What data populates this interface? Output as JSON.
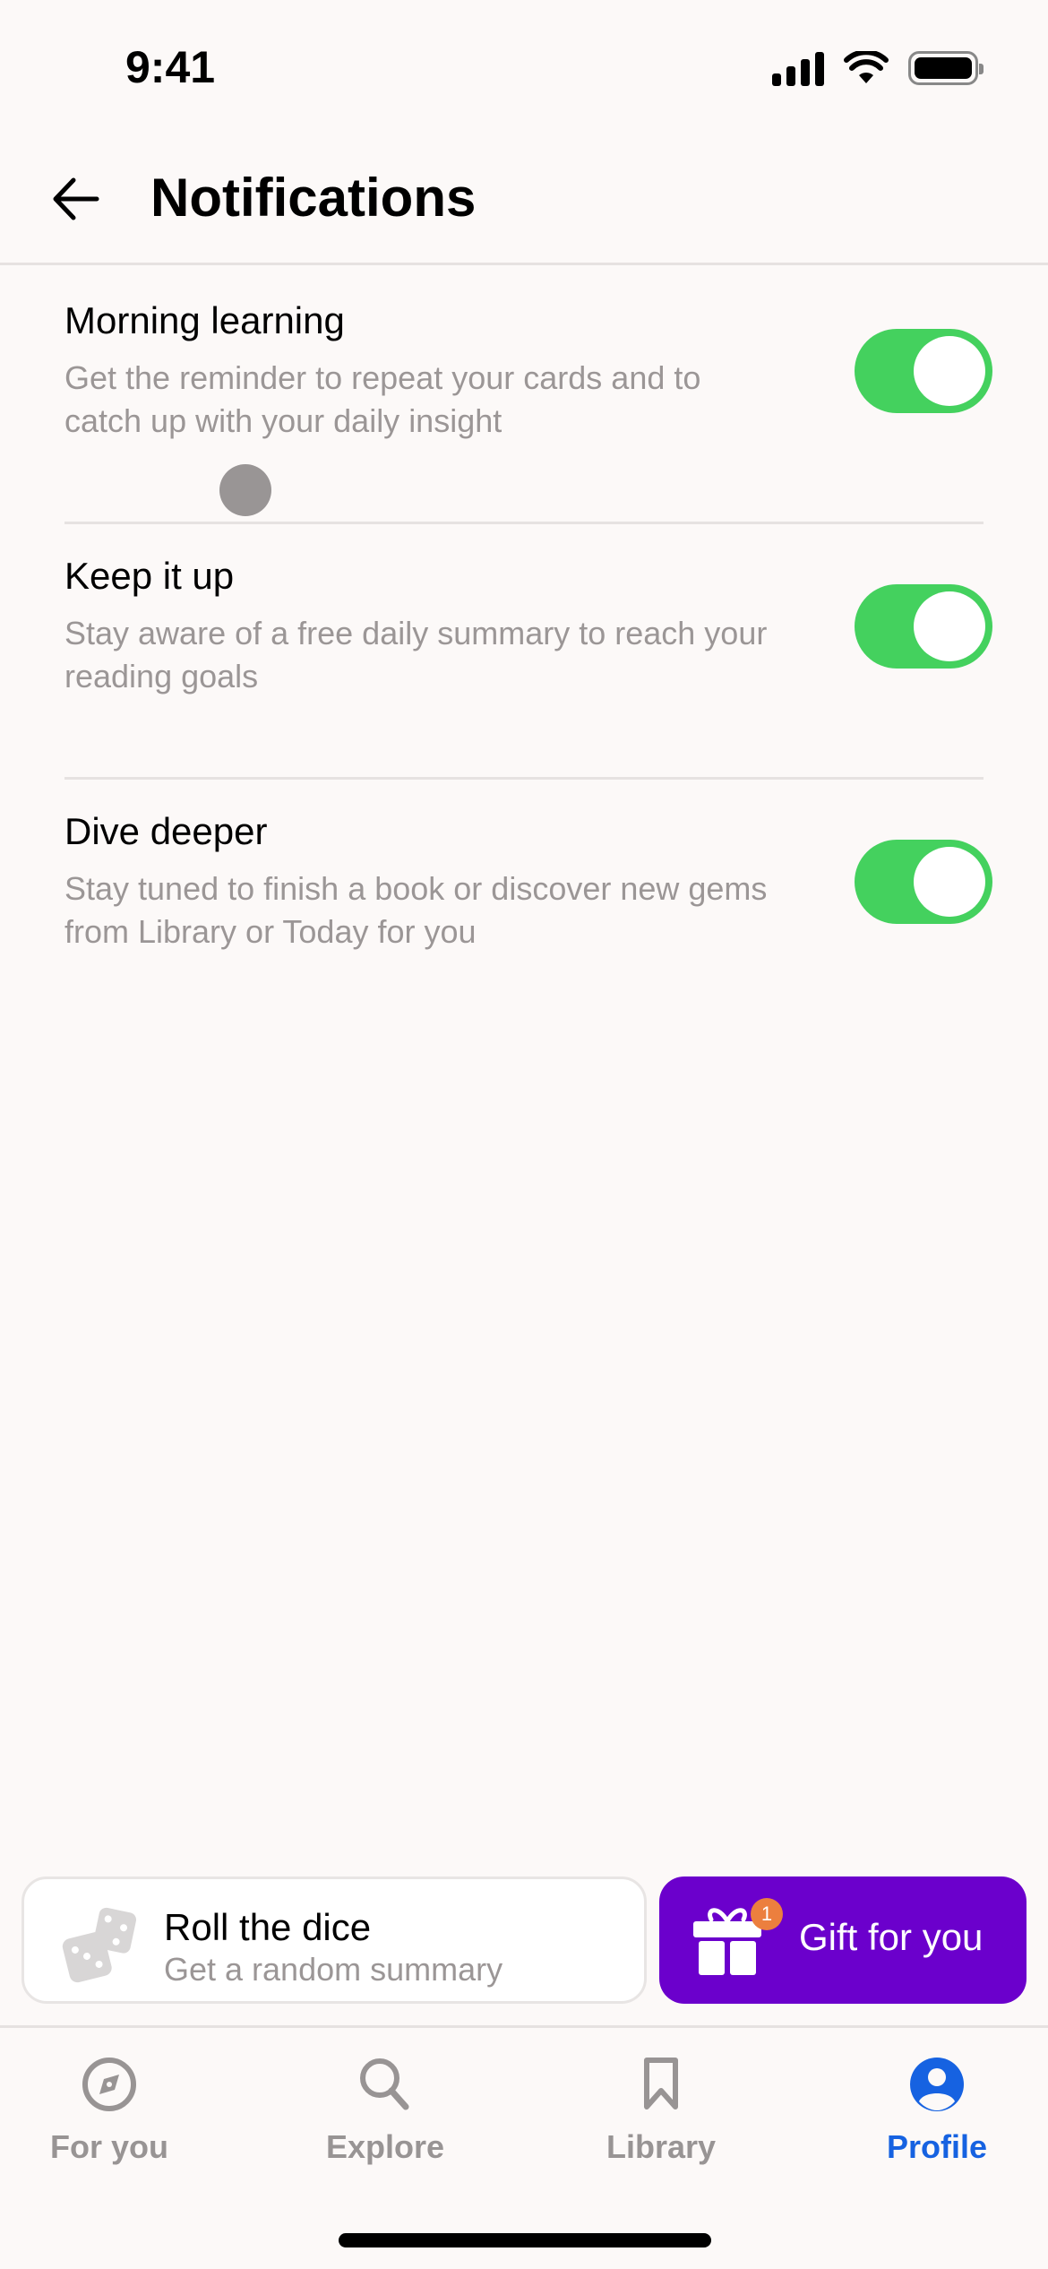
{
  "status_bar": {
    "time": "9:41"
  },
  "header": {
    "title": "Notifications",
    "back_icon": "arrow-left-icon"
  },
  "settings": [
    {
      "title": "Morning learning",
      "description": "Get the reminder to repeat your cards and to catch up with your daily insight",
      "enabled": true
    },
    {
      "title": "Keep it up",
      "description": "Stay aware of a free daily summary to reach your reading goals",
      "enabled": true
    },
    {
      "title": "Dive deeper",
      "description": "Stay tuned to finish a book or discover new gems from Library or Today for you",
      "enabled": true
    }
  ],
  "actions": {
    "dice": {
      "title": "Roll the dice",
      "subtitle": "Get a random summary",
      "icon": "dice-icon"
    },
    "gift": {
      "label": "Gift for you",
      "badge": "1",
      "icon": "gift-icon"
    }
  },
  "tab_bar": {
    "tabs": [
      {
        "label": "For you",
        "icon": "compass-icon",
        "active": false
      },
      {
        "label": "Explore",
        "icon": "search-icon",
        "active": false
      },
      {
        "label": "Library",
        "icon": "bookmark-icon",
        "active": false
      },
      {
        "label": "Profile",
        "icon": "profile-icon",
        "active": true
      }
    ]
  },
  "colors": {
    "background": "#fcf9f8",
    "toggle_on": "#44d15e",
    "gift_purple": "#6b00cc",
    "badge_orange": "#ec7f3e",
    "active_tab": "#1662e1",
    "inactive_tab": "#989494",
    "secondary_text": "#9b9696"
  }
}
